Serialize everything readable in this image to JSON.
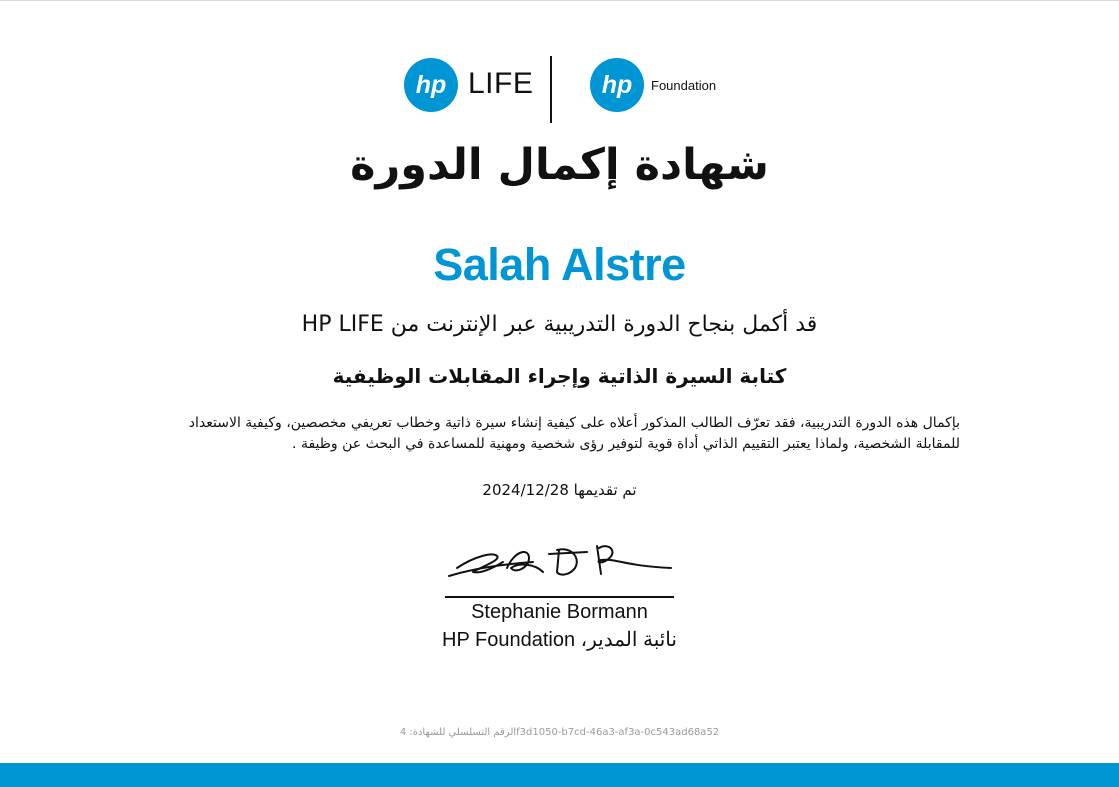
{
  "brand": {
    "accent_color": "#0096d6",
    "logo_mark": "hp",
    "life_label": "LIFE",
    "foundation_label": "Foundation"
  },
  "certificate": {
    "title": "شهادة إكمال الدورة",
    "recipient": "Salah Alstre",
    "completed_text": "قد أكمل بنجاح الدورة التدريبية عبر الإنترنت من HP LIFE",
    "course_name": "كتابة السيرة الذاتية وإجراء المقابلات الوظيفية",
    "description": "بإكمال هذه الدورة التدريبية، فقد تعرّف الطالب المذكور أعلاه على كيفية إنشاء سيرة ذاتية وخطاب تعريفي مخصصين، وكيفية الاستعداد للمقابلة الشخصية، ولماذا يعتبر التقييم الذاتي أداة قوية لتوفير رؤى شخصية ومهنية للمساعدة في البحث عن وظيفة .",
    "date_text": "تم تقديمها 2024/12/28",
    "signer_name": "Stephanie Bormann",
    "signer_role": "نائبة المدير، HP Foundation",
    "serial_text": "الرقم التسلسلي للشهادة: 4f3d1050-b7cd-46a3-af3a-0c543ad68a52"
  }
}
